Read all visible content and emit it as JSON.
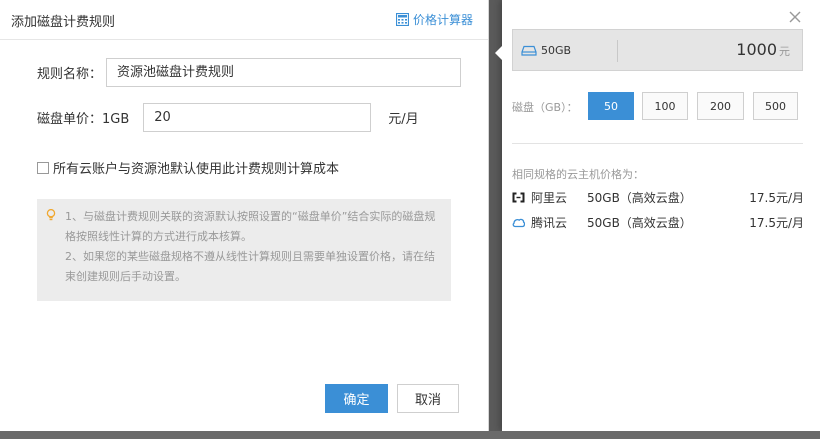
{
  "dialog": {
    "title": "添加磁盘计费规则",
    "calc_link": "价格计算器",
    "name_label": "规则名称：",
    "name_value": "资源池磁盘计费规则",
    "price_label": "磁盘单价：1GB",
    "price_value": "20",
    "price_unit": "元/月",
    "checkbox_label": "所有云账户与资源池默认使用此计费规则计算成本",
    "notes": [
      "1、与磁盘计费规则关联的资源默认按照设置的“磁盘单价”结合实际的磁盘规格按照线性计算的方式进行成本核算。",
      "2、如果您的某些磁盘规格不遵从线性计算规则且需要单独设置价格，请在结束创建规则后手动设置。"
    ],
    "ok_label": "确定",
    "cancel_label": "取消"
  },
  "calculator": {
    "selected_size": "50GB",
    "price": "1000",
    "currency": "元",
    "disk_label": "磁盘（GB）：",
    "sizes": [
      "50",
      "100",
      "200",
      "500"
    ],
    "active_size_index": 0,
    "same_spec_title": "相同规格的云主机价格为：",
    "vendors": [
      {
        "name": "阿里云",
        "spec": "50GB（高效云盘）",
        "price": "17.5元/月",
        "icon": "aliyun-icon"
      },
      {
        "name": "腾讯云",
        "spec": "50GB（高效云盘）",
        "price": "17.5元/月",
        "icon": "tencent-cloud-icon"
      }
    ]
  },
  "colors": {
    "accent": "#3b8fd6",
    "overlay": "#5a5a5a",
    "note_bg": "#ececec",
    "bulb": "#f0a830"
  }
}
